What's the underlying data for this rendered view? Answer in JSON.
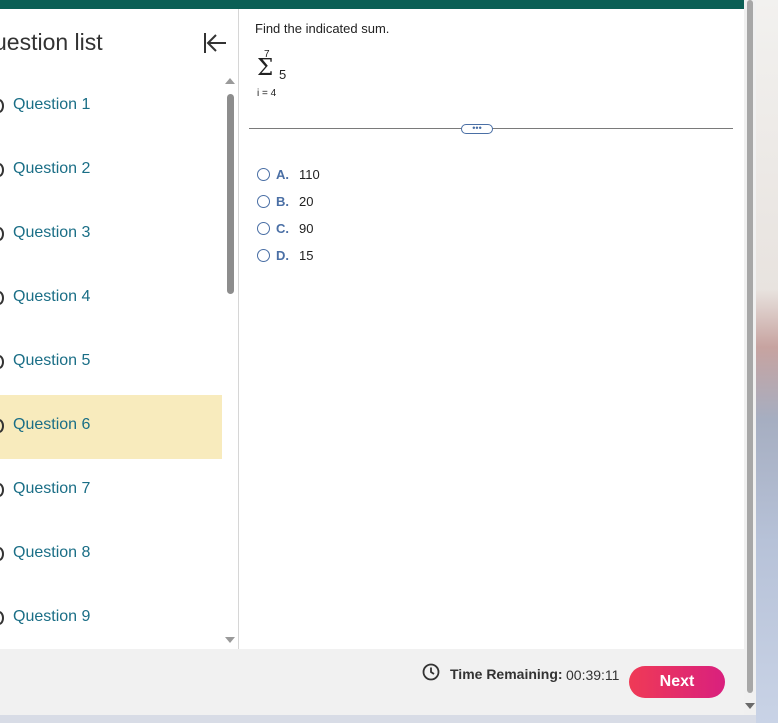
{
  "sidebar": {
    "title": "uestion list",
    "collapse_icon": "collapse-left-icon",
    "questions": [
      {
        "label": "Question 1",
        "active": false
      },
      {
        "label": "Question 2",
        "active": false
      },
      {
        "label": "Question 3",
        "active": false
      },
      {
        "label": "Question 4",
        "active": false
      },
      {
        "label": "Question 5",
        "active": false
      },
      {
        "label": "Question 6",
        "active": true
      },
      {
        "label": "Question 7",
        "active": false
      },
      {
        "label": "Question 8",
        "active": false
      },
      {
        "label": "Question 9",
        "active": false
      }
    ]
  },
  "question": {
    "prompt": "Find the indicated sum.",
    "sum_upper": "7",
    "sum_symbol": "Σ",
    "sum_term": "5",
    "sum_lower": "i = 4",
    "expand_handle": "•••",
    "options": [
      {
        "letter": "A.",
        "value": "110"
      },
      {
        "letter": "B.",
        "value": "20"
      },
      {
        "letter": "C.",
        "value": "90"
      },
      {
        "letter": "D.",
        "value": "15"
      }
    ]
  },
  "footer": {
    "time_label": "Time Remaining:",
    "time_value": "00:39:11",
    "next_label": "Next"
  },
  "colors": {
    "topbar": "#0b5f55",
    "active_question_bg": "#f8ebbd",
    "link_text": "#1a6e86",
    "option_letter": "#4a6fa5",
    "next_button_gradient": [
      "#ef3a56",
      "#d9207e"
    ]
  }
}
